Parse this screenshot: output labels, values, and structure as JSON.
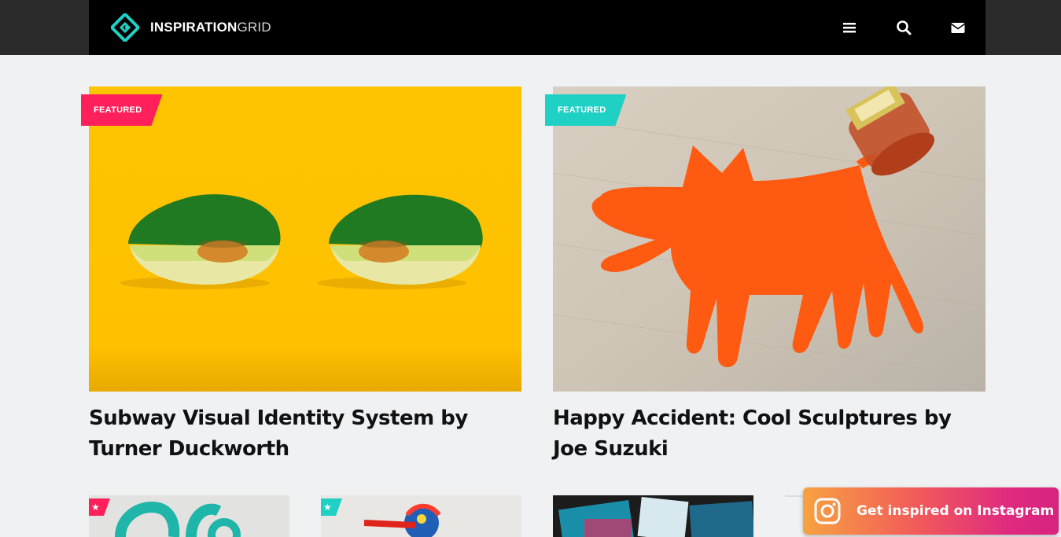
{
  "brand": {
    "bold": "INSPIRATION",
    "light": "GRID"
  },
  "nav": {
    "icons": [
      "menu-icon",
      "search-icon",
      "envelope-icon"
    ]
  },
  "colors": {
    "pink": "#ff1f5a",
    "teal": "#1fd1c4",
    "yellow": "#ffc107",
    "orange": "#ff5a12"
  },
  "featured": [
    {
      "badge": "FEATURED",
      "title": "Subway Visual Identity System by Turner Duckworth"
    },
    {
      "badge": "FEATURED",
      "title": "Happy Accident: Cool Sculptures by Joe Suzuki"
    }
  ],
  "small_posts": [
    {
      "badge_icon": "star-icon"
    },
    {
      "badge_icon": "star-icon"
    },
    {
      "badge_icon": ""
    }
  ],
  "instagram": {
    "label": "Get inspired on Instagram",
    "icon": "instagram-icon"
  }
}
